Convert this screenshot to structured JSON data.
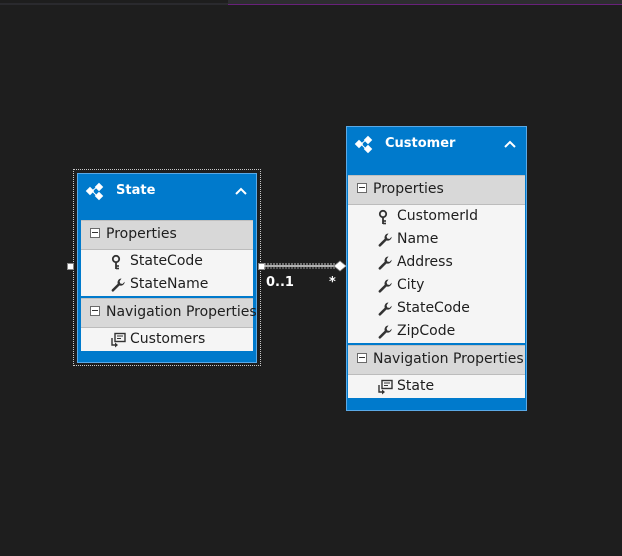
{
  "entities": {
    "state": {
      "title": "State",
      "properties_label": "Properties",
      "properties": [
        {
          "name": "StateCode",
          "icon": "key-icon"
        },
        {
          "name": "StateName",
          "icon": "wrench-icon"
        }
      ],
      "nav_label": "Navigation Properties",
      "nav": [
        {
          "name": "Customers",
          "icon": "navigation-property-icon"
        }
      ]
    },
    "customer": {
      "title": "Customer",
      "properties_label": "Properties",
      "properties": [
        {
          "name": "CustomerId",
          "icon": "key-icon"
        },
        {
          "name": "Name",
          "icon": "wrench-icon"
        },
        {
          "name": "Address",
          "icon": "wrench-icon"
        },
        {
          "name": "City",
          "icon": "wrench-icon"
        },
        {
          "name": "StateCode",
          "icon": "wrench-icon"
        },
        {
          "name": "ZipCode",
          "icon": "wrench-icon"
        }
      ],
      "nav_label": "Navigation Properties",
      "nav": [
        {
          "name": "State",
          "icon": "navigation-property-icon"
        }
      ]
    }
  },
  "association": {
    "state_end": "0..1",
    "customer_end": "*"
  },
  "colors": {
    "canvas": "#1e1e1e",
    "entity_header": "#007acc",
    "section_header": "#d8d8d8",
    "row_bg": "#f5f5f5"
  }
}
